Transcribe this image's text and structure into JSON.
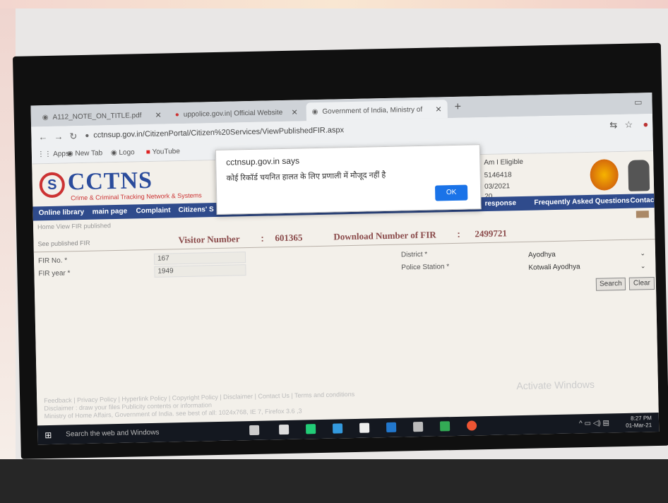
{
  "browser": {
    "tabs": [
      {
        "label": "A112_NOTE_ON_TITLE.pdf",
        "active": false
      },
      {
        "label": "uppolice.gov.in| Official Website",
        "active": false
      },
      {
        "label": "Government of India, Ministry of",
        "active": true
      }
    ],
    "url": "cctnsup.gov.in/CitizenPortal/Citizen%20Services/ViewPublishedFIR.aspx",
    "bookmarks": [
      "Apps",
      "New Tab",
      "Logo",
      "YouTube"
    ]
  },
  "site": {
    "logo_text": "CCTNS",
    "logo_subtitle": "Crime & Criminal Tracking Network & Systems",
    "menu": [
      "Online library",
      "main page",
      "Complaint",
      "Citizens' S",
      "response",
      "Frequently Asked Questions",
      "Contact"
    ],
    "header_partial": [
      "Am I Eligible",
      "5146418",
      "03/2021",
      "20"
    ],
    "breadcrumb": "Home  View FIR published",
    "banner": {
      "section_label": "See published FIR",
      "visitor_label": "Visitor Number",
      "visitor_value": "601365",
      "download_label": "Download Number of FIR",
      "download_value": "2499721"
    },
    "form": {
      "fir_no_label": "FIR No. *",
      "fir_no_value": "167",
      "fir_year_label": "FIR year *",
      "fir_year_value": "1949",
      "district_label": "District *",
      "district_value": "Ayodhya",
      "police_station_label": "Police Station *",
      "police_station_value": "Kotwali Ayodhya",
      "search_label": "Search",
      "clear_label": "Clear"
    },
    "footer_line1": "Feedback | Privacy Policy | Hyperlink Policy | Copyright Policy | Disclaimer | Contact Us | Terms and conditions",
    "footer_line2": "Disclaimer : draw your files Publicity contents or information",
    "footer_line3": "Ministry of Home Affairs, Government of India. see best of all: 1024x768, IE 7, Firefox 3.6 ,3",
    "watermark": "Activate Windows"
  },
  "dialog": {
    "title": "cctnsup.gov.in says",
    "message": "कोई रिकॉर्ड चयनित हालत के लिए प्रणाली में मौजूद नहीं है",
    "ok_label": "OK"
  },
  "taskbar": {
    "search_text": "Search the web and Windows",
    "time": "8:27 PM",
    "date": "01-Mar-21"
  }
}
